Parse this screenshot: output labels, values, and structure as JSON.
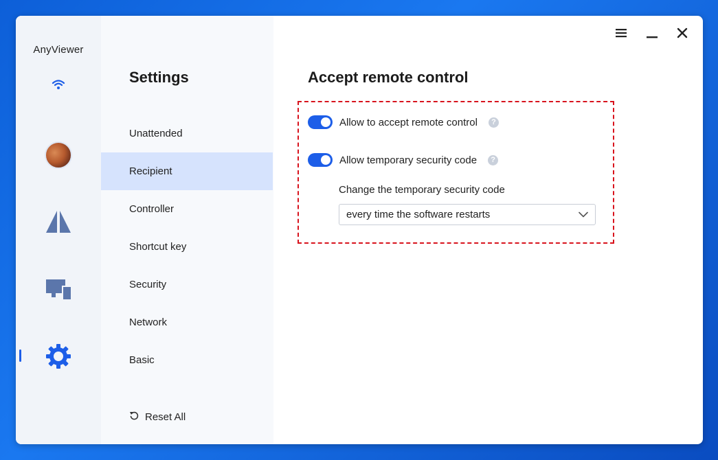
{
  "app": {
    "name": "AnyViewer"
  },
  "sidebar": {
    "title": "Settings",
    "items": [
      {
        "label": "Unattended",
        "active": false
      },
      {
        "label": "Recipient",
        "active": true
      },
      {
        "label": "Controller",
        "active": false
      },
      {
        "label": "Shortcut key",
        "active": false
      },
      {
        "label": "Security",
        "active": false
      },
      {
        "label": "Network",
        "active": false
      },
      {
        "label": "Basic",
        "active": false
      }
    ],
    "reset_label": "Reset All"
  },
  "rail": {
    "icons": [
      "wifi-icon",
      "avatar",
      "anyviewer-logo-icon",
      "devices-icon",
      "gear-icon"
    ],
    "active": "gear-icon"
  },
  "main": {
    "title": "Accept remote control",
    "options": [
      {
        "label": "Allow to accept remote control",
        "enabled": true
      },
      {
        "label": "Allow temporary security code",
        "enabled": true
      }
    ],
    "change_code_label": "Change the temporary security code",
    "change_code_value": "every time the software restarts"
  },
  "colors": {
    "accent": "#1d5ee8",
    "rail_icon": "#5b76ab",
    "highlight_border": "#d8121c",
    "active_nav_bg": "#d6e3fd"
  }
}
